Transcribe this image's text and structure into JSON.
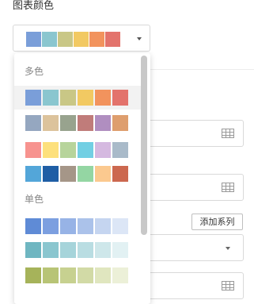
{
  "section": {
    "title": "图表颜色"
  },
  "selector": {
    "selected_colors": [
      "#7a9ed9",
      "#8ac6cf",
      "#c9c786",
      "#f2c962",
      "#f2935d",
      "#e3736c"
    ]
  },
  "dropdown": {
    "groups": [
      {
        "label": "多色",
        "palettes": [
          [
            "#7a9ed9",
            "#8ac6cf",
            "#c9c786",
            "#f2c962",
            "#f2935d",
            "#e3736c"
          ],
          [
            "#95a7c0",
            "#dcc39c",
            "#98a38e",
            "#c07c7a",
            "#b08ec0",
            "#de9e6e"
          ],
          [
            "#f7938f",
            "#fde07c",
            "#b7d49b",
            "#72cfe3",
            "#d5b9e0",
            "#a9bac9"
          ],
          [
            "#53a6d9",
            "#1f5ea5",
            "#a59688",
            "#94d6a3",
            "#fbc98f",
            "#cc684f"
          ]
        ]
      },
      {
        "label": "单色",
        "palettes": [
          [
            "#5f8bd6",
            "#7c9fe0",
            "#97b3e6",
            "#abc2ea",
            "#c5d5f0",
            "#dce6f6"
          ],
          [
            "#6fb6c1",
            "#8ac6cf",
            "#a6d4da",
            "#b9dde2",
            "#cee7ea",
            "#e2f1f3"
          ],
          [
            "#a6b35a",
            "#b8c476",
            "#c7d190",
            "#d2daa6",
            "#e0e6bf",
            "#ecf0d8"
          ]
        ]
      }
    ]
  },
  "form": {
    "add_series_label": "添加系列"
  }
}
